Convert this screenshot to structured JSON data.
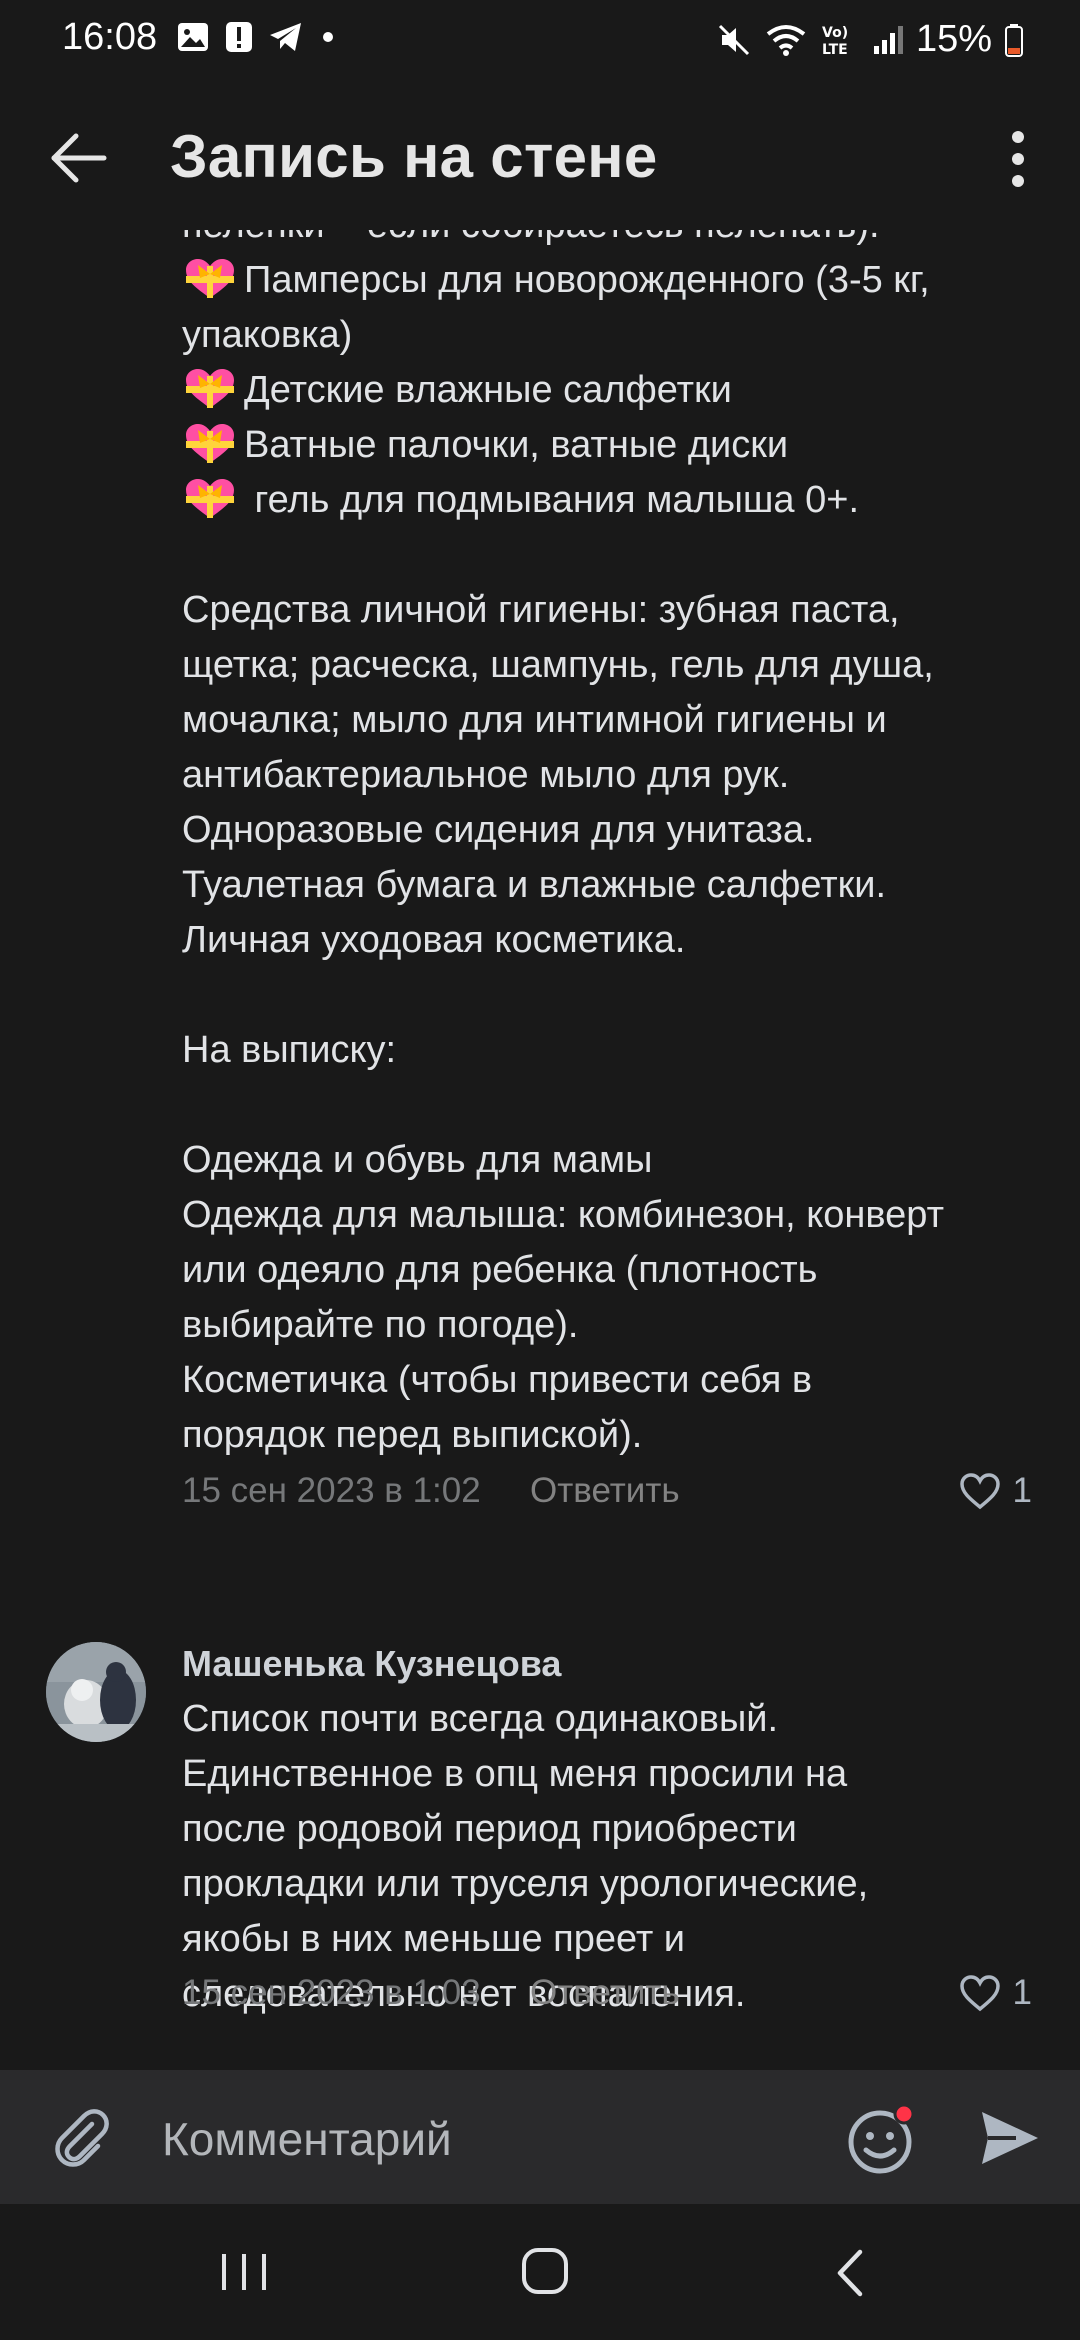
{
  "status_bar": {
    "time": "16:08",
    "battery": "15%",
    "icons": [
      "gallery-icon",
      "alert-icon",
      "telegram-icon",
      "dot-icon",
      "mute-icon",
      "wifi-icon",
      "volte-icon",
      "signal-icon",
      "battery-icon"
    ]
  },
  "app_bar": {
    "title": "Запись на стене"
  },
  "comments": [
    {
      "lines": [
        {
          "text": "пеленки – если собираетесь пеленать)."
        },
        {
          "text": "Памперсы для новорожденного (3-5 кг,",
          "emoji": "heart-with-ribbon"
        },
        {
          "text": "упаковка)"
        },
        {
          "text": "Детские влажные салфетки",
          "emoji": "heart-with-ribbon"
        },
        {
          "text": "Ватные палочки, ватные диски",
          "emoji": "heart-with-ribbon"
        },
        {
          "text": " гель для подмывания малыша 0+.",
          "emoji": "heart-with-ribbon"
        },
        {
          "text": ""
        },
        {
          "text": "Средства личной гигиены: зубная паста,"
        },
        {
          "text": "щетка; расческа, шампунь, гель для душа,"
        },
        {
          "text": "мочалка; мыло для интимной гигиены и"
        },
        {
          "text": "антибактериальное мыло для рук."
        },
        {
          "text": "Одноразовые сидения для унитаза."
        },
        {
          "text": "Туалетная бумага и влажные салфетки."
        },
        {
          "text": "Личная уходовая косметика."
        },
        {
          "text": ""
        },
        {
          "text": "На выписку:"
        },
        {
          "text": ""
        },
        {
          "text": "Одежда и обувь для мамы"
        },
        {
          "text": "Одежда для малыша: комбинезон, конверт"
        },
        {
          "text": "или одеяло для ребенка (плотность"
        },
        {
          "text": "выбирайте по погоде)."
        },
        {
          "text": "Косметичка (чтобы привести себя в"
        },
        {
          "text": "порядок перед выпиской)."
        }
      ],
      "date": "15 сен 2023 в 1:02",
      "reply_label": "Ответить",
      "likes": "1"
    },
    {
      "author": "Машенька Кузнецова",
      "lines": [
        {
          "text": "Список почти всегда одинаковый."
        },
        {
          "text": "Единственное в опц меня просили на"
        },
        {
          "text": "после родовой период приобрести"
        },
        {
          "text": "прокладки или труселя урологические,"
        },
        {
          "text": "якобы в них меньше преет и"
        },
        {
          "text": "следовательно нет воспаления."
        }
      ],
      "date": "15 сен 2023 в 1:03",
      "reply_label": "Ответить",
      "likes": "1"
    }
  ],
  "composer": {
    "placeholder": "Комментарий"
  },
  "colors": {
    "background": "#191919",
    "composer": "#2a2a2c",
    "text": "#e1e3e6",
    "meta": "#76787a",
    "badge": "#ff3347"
  }
}
